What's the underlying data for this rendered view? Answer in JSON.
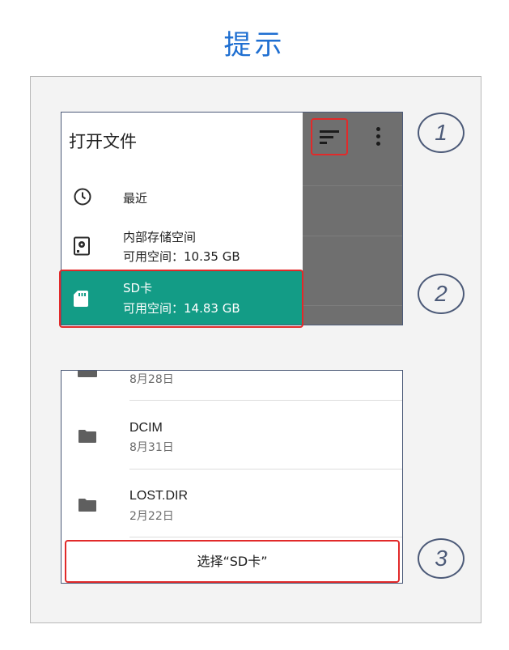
{
  "header": {
    "title": "提示"
  },
  "panel1": {
    "drawer_title": "打开文件",
    "items": [
      {
        "icon": "clock-icon",
        "label": "最近",
        "sub": ""
      },
      {
        "icon": "hard-drive-icon",
        "label": "内部存储空间",
        "sub": "可用空间：10.35 GB"
      },
      {
        "icon": "sd-card-icon",
        "label": "SD卡",
        "sub": "可用空间：14.83 GB"
      }
    ],
    "toolbar_icons": [
      "sort-icon",
      "more-vert-icon"
    ]
  },
  "panel2": {
    "partial_date": "8月28日",
    "files": [
      {
        "name": "DCIM",
        "date": "8月31日"
      },
      {
        "name": "LOST.DIR",
        "date": "2月22日"
      }
    ],
    "select_button": "选择“SD卡”"
  },
  "steps": [
    "1",
    "2",
    "3"
  ],
  "colors": {
    "title": "#1f6fd1",
    "sd_highlight": "#139c86",
    "callout_red": "#e12a2a",
    "badge": "#4c5a78"
  }
}
